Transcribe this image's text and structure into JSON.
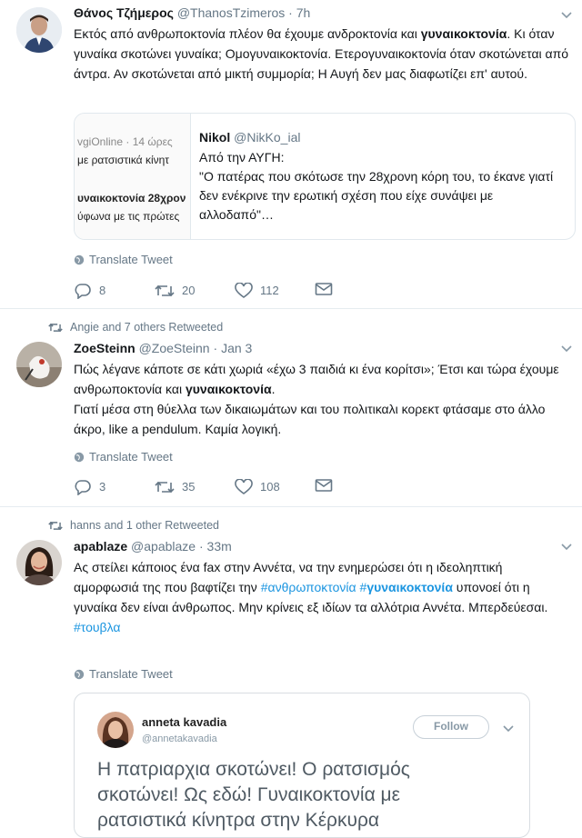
{
  "tweet1": {
    "name": "Θάνος Τζήμερος",
    "handle": "@ThanosTzimeros",
    "time": "7h",
    "text_a": "Εκτός από ανθρωποκτονία πλέον θα έχουμε ανδροκτονία και ",
    "text_bold": "γυναικοκτονία",
    "text_b": ". Κι όταν γυναίκα σκοτώνει γυναίκα; Ομογυναικοκτονία. Ετερογυναικοκτονία όταν σκοτώνεται από άντρα. Αν σκοτώνεται από μικτή συμμορία; Η Αυγή δεν μας διαφωτίζει επ' αυτού.",
    "quote": {
      "thumb_line1": "vgiOnline · 14 ώρες",
      "thumb_line2": "με ρατσιστικά κίνητ",
      "thumb_line3": "υναικοκτονία 28χρον",
      "thumb_line4": "ύφωνα με τις πρώτες",
      "name": "Nikol",
      "handle": "@NikKo_ial",
      "line1": "Από την ΑΥΓΗ:",
      "line2": "\"Ο πατέρας που σκότωσε την 28χρονη κόρη του, το έκανε γιατί δεν ενέκρινε την ερωτική σχέση που είχε συνάψει με αλλοδαπό\"…"
    },
    "translate": "Translate Tweet",
    "replies": "8",
    "retweets": "20",
    "likes": "112"
  },
  "tweet2": {
    "context": "Angie and 7 others Retweeted",
    "name": "ZoeSteinn",
    "handle": "@ZoeSteinn",
    "time": "Jan 3",
    "text_a": "Πώς λέγανε κάποτε σε κάτι χωριά «έχω 3 παιδιά κι ένα κορίτσι»; Έτσι και τώρα έχουμε ανθρωποκτονία και ",
    "text_bold": "γυναικοκτονία",
    "text_b": ".",
    "text_c": "Γιατί μέσα στη θύελλα των δικαιωμάτων και του πολιτικαλι κορεκτ φτάσαμε στο άλλο άκρο, like a pendulum. Καμία λογική.",
    "translate": "Translate Tweet",
    "replies": "3",
    "retweets": "35",
    "likes": "108"
  },
  "tweet3": {
    "context": "hanns and 1 other Retweeted",
    "name": "apablaze",
    "handle": "@apablaze",
    "time": "33m",
    "text_a": "Ας στείλει κάποιος ένα fax στην Αννέτα, να την ενημερώσει ότι η ιδεοληπτική αμορφωσιά της που βαφτίζει την ",
    "tag1": "#ανθρωποκτονία",
    "tag2_prefix": "#",
    "tag2_bold": "γυναικοκτονία",
    "text_b": " υπονοεί ότι η γυναίκα δεν είναι άνθρωπος. Μην κρίνεις εξ ιδίων τα αλλότρια Αννέτα. Μπερδεύεσαι.",
    "tag3": "#τουβλα",
    "translate": "Translate Tweet",
    "embed": {
      "name": "anneta kavadia",
      "handle": "@annetakavadia",
      "follow": "Follow",
      "text": "Η πατριαρχια σκοτώνει! Ο ρατσισμός σκοτώνει! Ως εδώ! Γυναικοκτονία με ρατσιστικά κίνητρα στην Κέρκυρα"
    }
  },
  "colors": {
    "link": "#1b95e0",
    "muted": "#657786",
    "border": "#e6ecf0"
  }
}
